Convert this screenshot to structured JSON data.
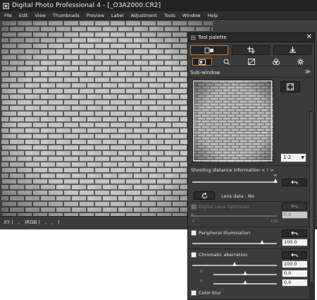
{
  "window": {
    "title": "Digital Photo Professional 4 - [_O3A2000.CR2]"
  },
  "menu": {
    "items": [
      "File",
      "Edit",
      "View",
      "Thumbnails",
      "Preview",
      "Label",
      "Adjustment",
      "Tools",
      "Window",
      "Help"
    ]
  },
  "status": {
    "text": "XY (   ,   )RGB (   ,   ,   )"
  },
  "palette": {
    "title": "Tool palette",
    "close": "✕",
    "subwindow_label": "Sub-window",
    "subwindow_collapse": "≫",
    "zoom_value": "1:2",
    "shooting_distance": {
      "label": "Shooting distance information  < ! >",
      "infinity": "∞",
      "value_fraction": 1.0
    },
    "lens_data": {
      "label": "Lens data : No"
    },
    "dlo": {
      "label": "Digital Lens Optimizer",
      "value": "0.0",
      "min_label": "0",
      "max_label": "100",
      "enabled": false
    },
    "peripheral": {
      "label": "Peripheral illumination",
      "value": "100.0"
    },
    "chromatic": {
      "label": "Chromatic aberration",
      "value": "100.0",
      "r_label": "R",
      "r_value": "0.0",
      "b_label": "B",
      "b_value": "0.0"
    },
    "color_blur": {
      "label": "Color blur"
    }
  },
  "colors": {
    "accent": "#d07a22",
    "window_bg": "#3f3f3f",
    "title_bg": "#222222"
  }
}
